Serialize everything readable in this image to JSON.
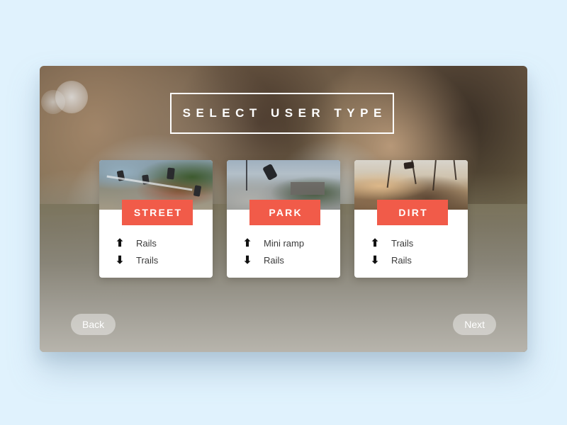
{
  "background": {
    "page_color": "#e0f2fd",
    "accent_color": "#f15b49"
  },
  "header": {
    "title": "SELECT USER TYPE"
  },
  "cards": [
    {
      "badge": "STREET",
      "photo": "bmx-street-rail-photo",
      "options": [
        {
          "arrow": "up-arrow-icon",
          "glyph": "⬆",
          "label": "Rails"
        },
        {
          "arrow": "down-arrow-icon",
          "glyph": "⬇",
          "label": "Trails"
        }
      ]
    },
    {
      "badge": "PARK",
      "photo": "bmx-park-flip-photo",
      "options": [
        {
          "arrow": "up-arrow-icon",
          "glyph": "⬆",
          "label": "Mini ramp"
        },
        {
          "arrow": "down-arrow-icon",
          "glyph": "⬇",
          "label": "Rails"
        }
      ]
    },
    {
      "badge": "DIRT",
      "photo": "bmx-dirt-trails-photo",
      "options": [
        {
          "arrow": "up-arrow-icon",
          "glyph": "⬆",
          "label": "Trails"
        },
        {
          "arrow": "down-arrow-icon",
          "glyph": "⬇",
          "label": "Rails"
        }
      ]
    }
  ],
  "footer": {
    "back_label": "Back",
    "next_label": "Next"
  }
}
